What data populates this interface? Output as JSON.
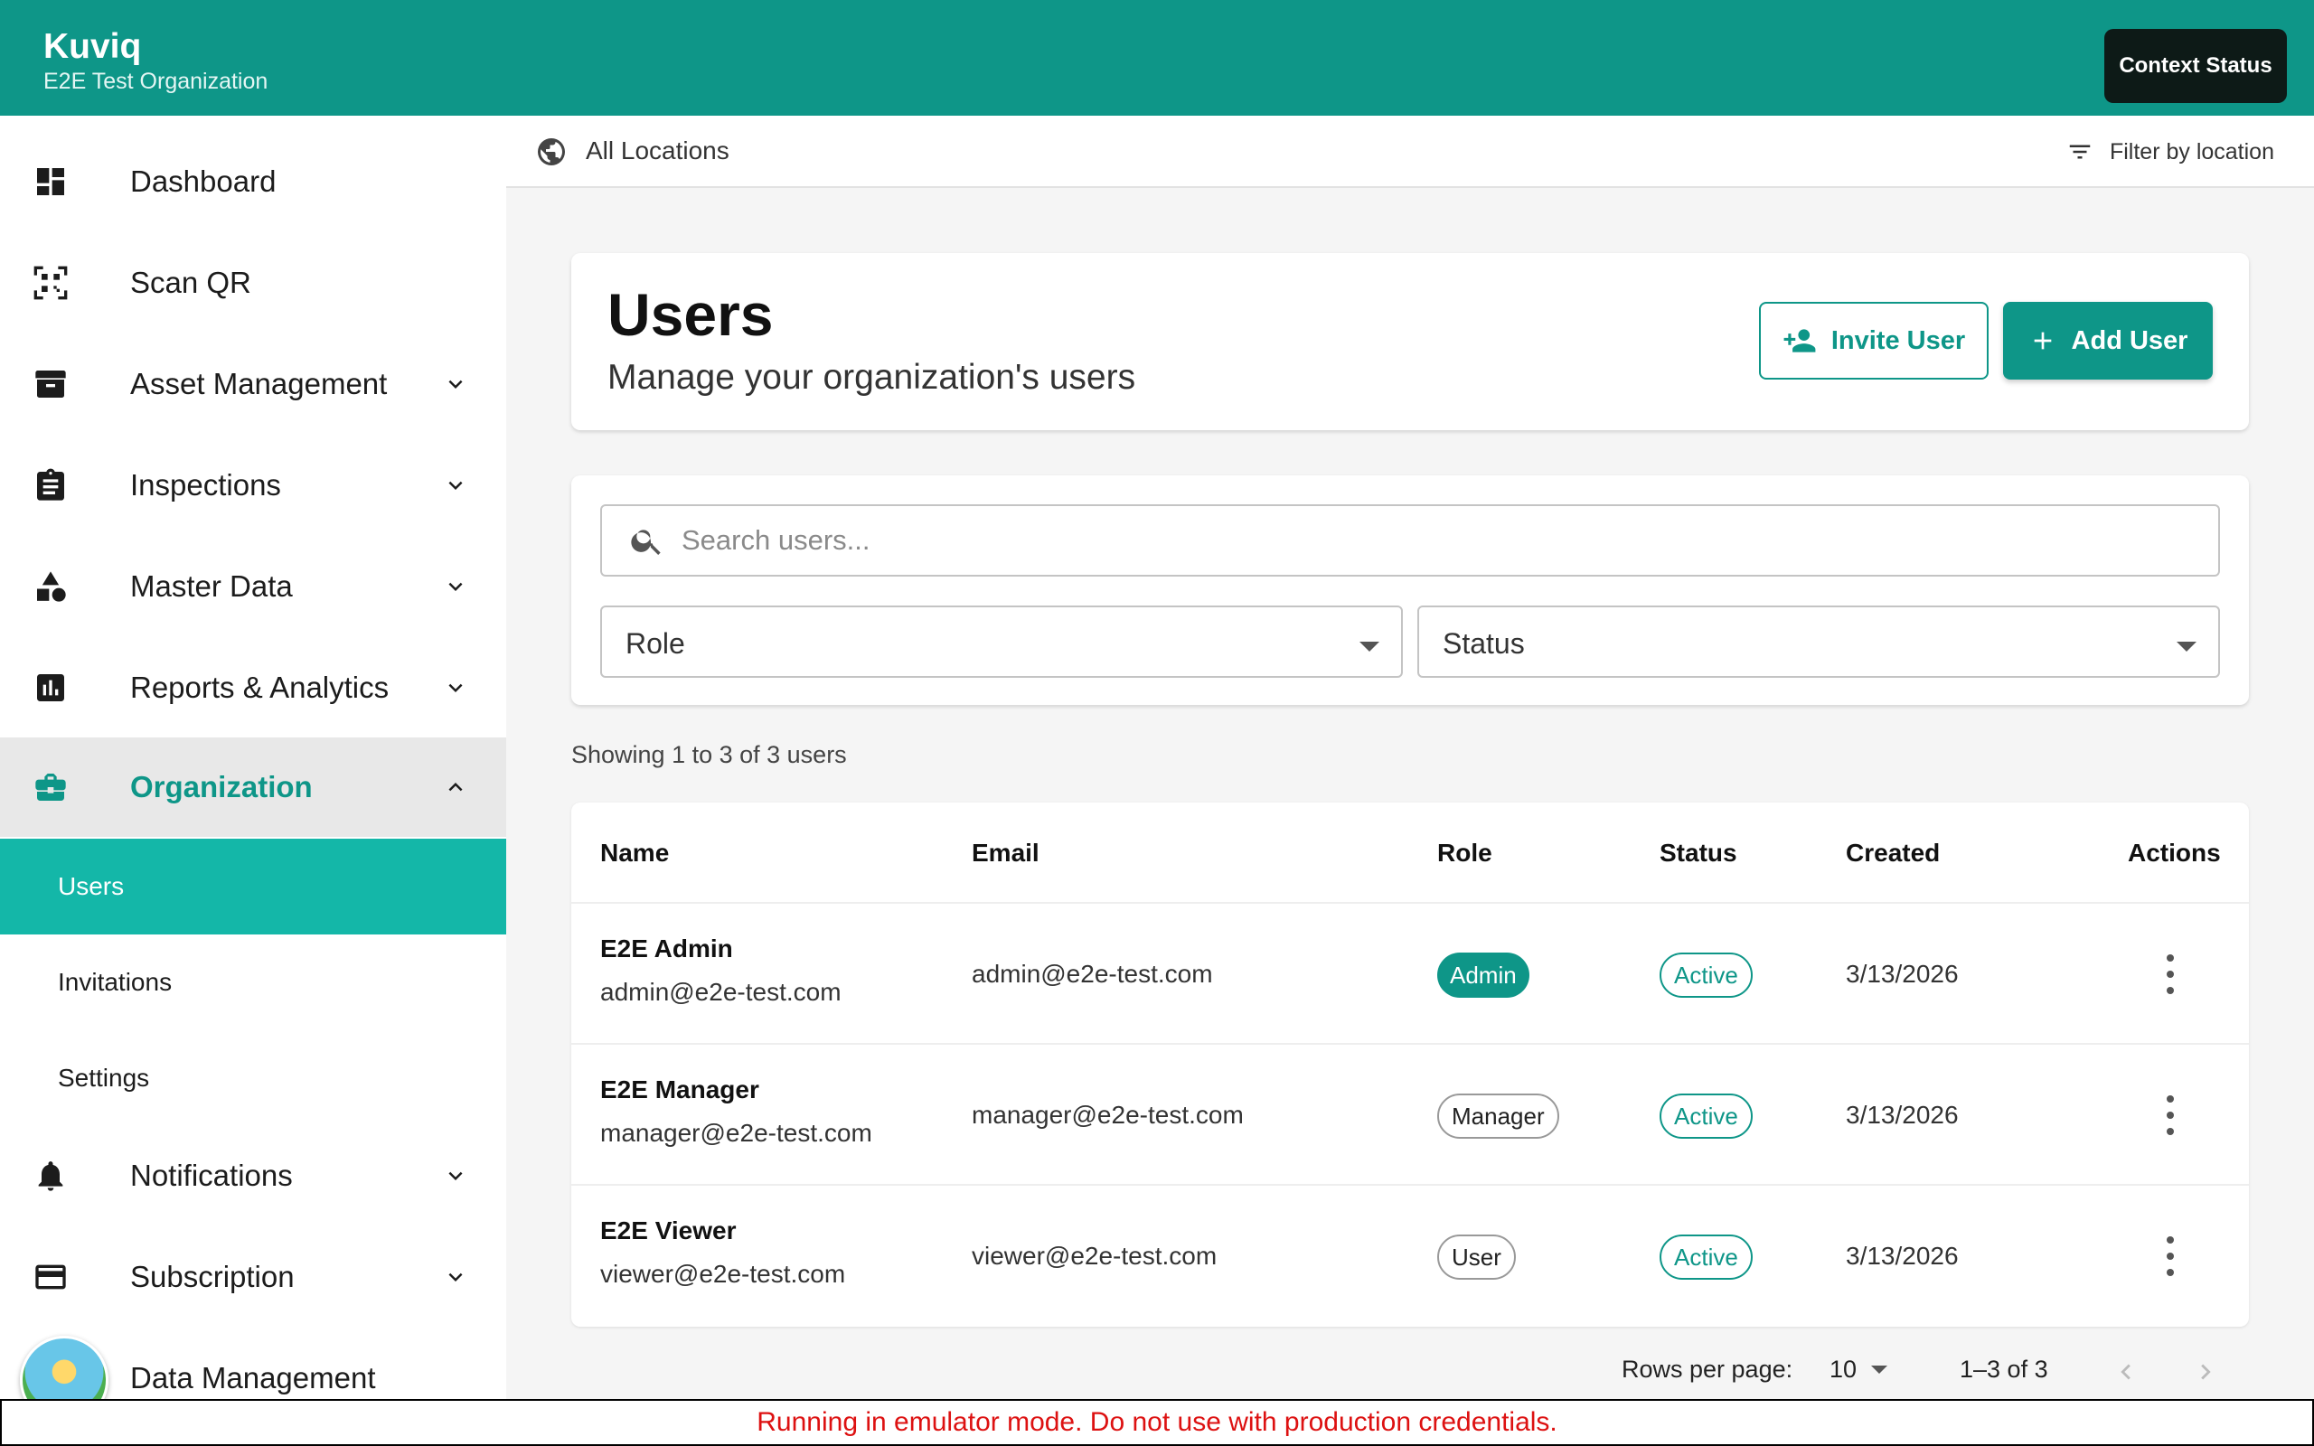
{
  "app": {
    "name": "Kuviq",
    "organization": "E2E Test Organization",
    "context_button": "Context Status"
  },
  "sidebar": {
    "items": [
      {
        "label": "Dashboard",
        "icon": "dashboard-icon",
        "expandable": false
      },
      {
        "label": "Scan QR",
        "icon": "qr-scan-icon",
        "expandable": false
      },
      {
        "label": "Asset Management",
        "icon": "archive-box-icon",
        "expandable": true
      },
      {
        "label": "Inspections",
        "icon": "clipboard-icon",
        "expandable": true
      },
      {
        "label": "Master Data",
        "icon": "shapes-icon",
        "expandable": true
      },
      {
        "label": "Reports & Analytics",
        "icon": "bar-chart-icon",
        "expandable": true
      },
      {
        "label": "Organization",
        "icon": "briefcase-icon",
        "expandable": true,
        "expanded": true,
        "active": true
      },
      {
        "label": "Notifications",
        "icon": "bell-icon",
        "expandable": true
      },
      {
        "label": "Subscription",
        "icon": "credit-card-icon",
        "expandable": true
      },
      {
        "label": "Data Management",
        "icon": "avatar",
        "expandable": false
      }
    ],
    "sub_items": [
      {
        "label": "Users",
        "selected": true
      },
      {
        "label": "Invitations",
        "selected": false
      },
      {
        "label": "Settings",
        "selected": false
      }
    ]
  },
  "location_bar": {
    "current": "All Locations",
    "filter_label": "Filter by location"
  },
  "page": {
    "title": "Users",
    "subtitle": "Manage your organization's users",
    "invite_button": "Invite User",
    "add_button": "Add User"
  },
  "filters": {
    "search_placeholder": "Search users...",
    "role_label": "Role",
    "status_label": "Status"
  },
  "summary": "Showing 1 to 3 of 3 users",
  "table": {
    "columns": [
      "Name",
      "Email",
      "Role",
      "Status",
      "Created",
      "Actions"
    ],
    "rows": [
      {
        "name": "E2E Admin",
        "name_email": "admin@e2e-test.com",
        "email": "admin@e2e-test.com",
        "role": "Admin",
        "status": "Active",
        "created": "3/13/2026"
      },
      {
        "name": "E2E Manager",
        "name_email": "manager@e2e-test.com",
        "email": "manager@e2e-test.com",
        "role": "Manager",
        "status": "Active",
        "created": "3/13/2026"
      },
      {
        "name": "E2E Viewer",
        "name_email": "viewer@e2e-test.com",
        "email": "viewer@e2e-test.com",
        "role": "User",
        "status": "Active",
        "created": "3/13/2026"
      }
    ]
  },
  "pagination": {
    "rows_per_page_label": "Rows per page:",
    "rows_per_page": "10",
    "range": "1–3 of 3"
  },
  "banner": "Running in emulator mode. Do not use with production credentials.",
  "colors": {
    "brand": "#0e9688",
    "selected_nav": "#14b7a8",
    "banner_text": "#dd1111"
  }
}
